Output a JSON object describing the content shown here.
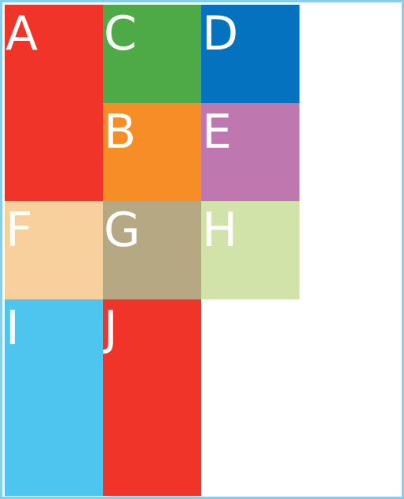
{
  "colors": {
    "border": "#87ceeb",
    "background": "#ffffff",
    "text": "#ffffff"
  },
  "tiles": [
    {
      "label": "A",
      "color": "#f0342a"
    },
    {
      "label": "C",
      "color": "#4daa47"
    },
    {
      "label": "D",
      "color": "#0572bf"
    },
    {
      "label": "B",
      "color": "#f68d26"
    },
    {
      "label": "E",
      "color": "#bf77b0"
    },
    {
      "label": "F",
      "color": "#f8d09e"
    },
    {
      "label": "G",
      "color": "#b6a882"
    },
    {
      "label": "H",
      "color": "#d1e3a9"
    },
    {
      "label": "I",
      "color": "#4dc5ee"
    },
    {
      "label": "J",
      "color": "#f0342a"
    }
  ]
}
